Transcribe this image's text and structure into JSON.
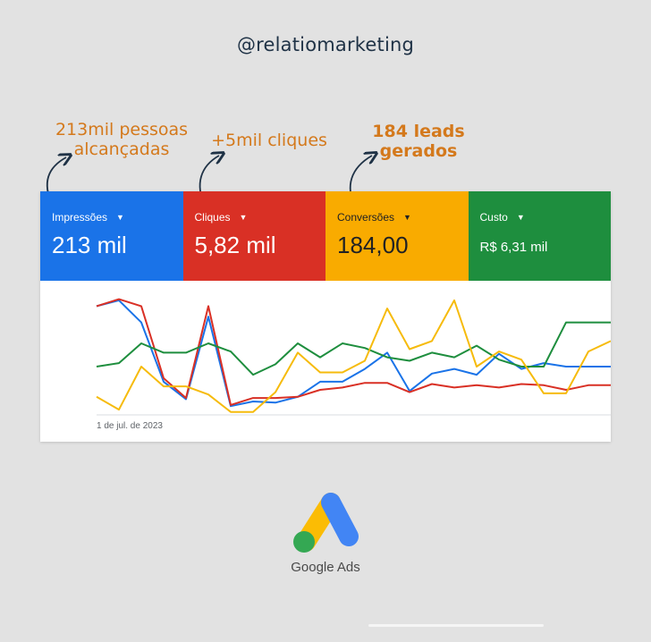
{
  "handle": "@relatiomarketing",
  "annotations": {
    "impressions_line1": "213mil pessoas",
    "impressions_line2": "alcançadas",
    "clicks": "+5mil cliques",
    "leads_line1": "184 leads",
    "leads_line2": "gerados"
  },
  "metrics": [
    {
      "label": "Impressões",
      "value": "213 mil",
      "color": "#1a73e8"
    },
    {
      "label": "Cliques",
      "value": "5,82 mil",
      "color": "#d93025"
    },
    {
      "label": "Conversões",
      "value": "184,00",
      "color": "#f9ab00"
    },
    {
      "label": "Custo",
      "value": "R$ 6,31 mil",
      "color": "#1e8e3e"
    }
  ],
  "chart_data": {
    "type": "line",
    "x_start_label": "1 de jul. de 2023",
    "grid": true,
    "series": [
      {
        "color": "#1a73e8",
        "values": [
          0.92,
          0.97,
          0.78,
          0.27,
          0.12,
          0.83,
          0.06,
          0.1,
          0.09,
          0.14,
          0.27,
          0.27,
          0.38,
          0.52,
          0.19,
          0.34,
          0.38,
          0.33,
          0.51,
          0.38,
          0.43,
          0.4,
          0.4,
          0.4
        ]
      },
      {
        "color": "#d93025",
        "values": [
          0.92,
          0.98,
          0.92,
          0.3,
          0.13,
          0.92,
          0.07,
          0.13,
          0.13,
          0.14,
          0.2,
          0.22,
          0.26,
          0.26,
          0.18,
          0.25,
          0.22,
          0.24,
          0.22,
          0.25,
          0.24,
          0.2,
          0.24,
          0.24
        ]
      },
      {
        "color": "#1e8e3e",
        "values": [
          0.4,
          0.43,
          0.6,
          0.52,
          0.52,
          0.6,
          0.53,
          0.33,
          0.42,
          0.6,
          0.48,
          0.6,
          0.56,
          0.48,
          0.45,
          0.52,
          0.48,
          0.58,
          0.46,
          0.4,
          0.4,
          0.78,
          0.78,
          0.78
        ]
      },
      {
        "color": "#f6bb0c",
        "values": [
          0.14,
          0.03,
          0.4,
          0.23,
          0.23,
          0.16,
          0.01,
          0.01,
          0.18,
          0.52,
          0.35,
          0.35,
          0.45,
          0.9,
          0.55,
          0.62,
          0.97,
          0.4,
          0.53,
          0.46,
          0.17,
          0.17,
          0.53,
          0.62
        ]
      }
    ]
  }
}
